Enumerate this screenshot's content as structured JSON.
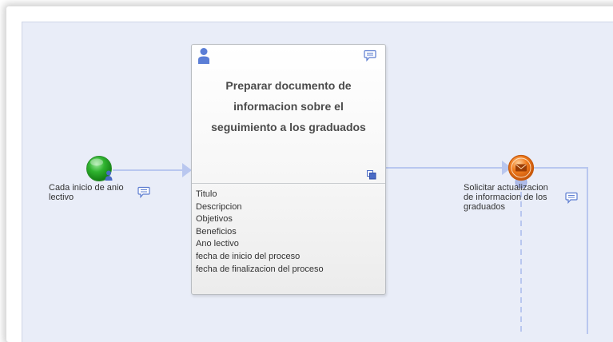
{
  "colors": {
    "canvas_bg": "#e9edf8",
    "connector": "#b9c7ef",
    "start_event": "#2fb32f",
    "message_event": "#f07c1e",
    "icon_blue": "#4a6bc5"
  },
  "start_event": {
    "label_lines": [
      "Cada inicio de anio",
      "lectivo"
    ],
    "icon": "user-start-icon"
  },
  "task": {
    "title": "Preparar documento de informacion sobre el seguimiento a los graduados",
    "icon": "user-icon",
    "attributes": [
      "Titulo",
      "Descripcion",
      "Objetivos",
      "Beneficios",
      "Ano lectivo",
      "fecha de inicio del proceso",
      "fecha de finalizacion del proceso"
    ]
  },
  "message_event": {
    "label_lines": [
      "Solicitar actualizacion",
      "de informacion de los",
      "graduados"
    ],
    "icon": "envelope-icon"
  }
}
